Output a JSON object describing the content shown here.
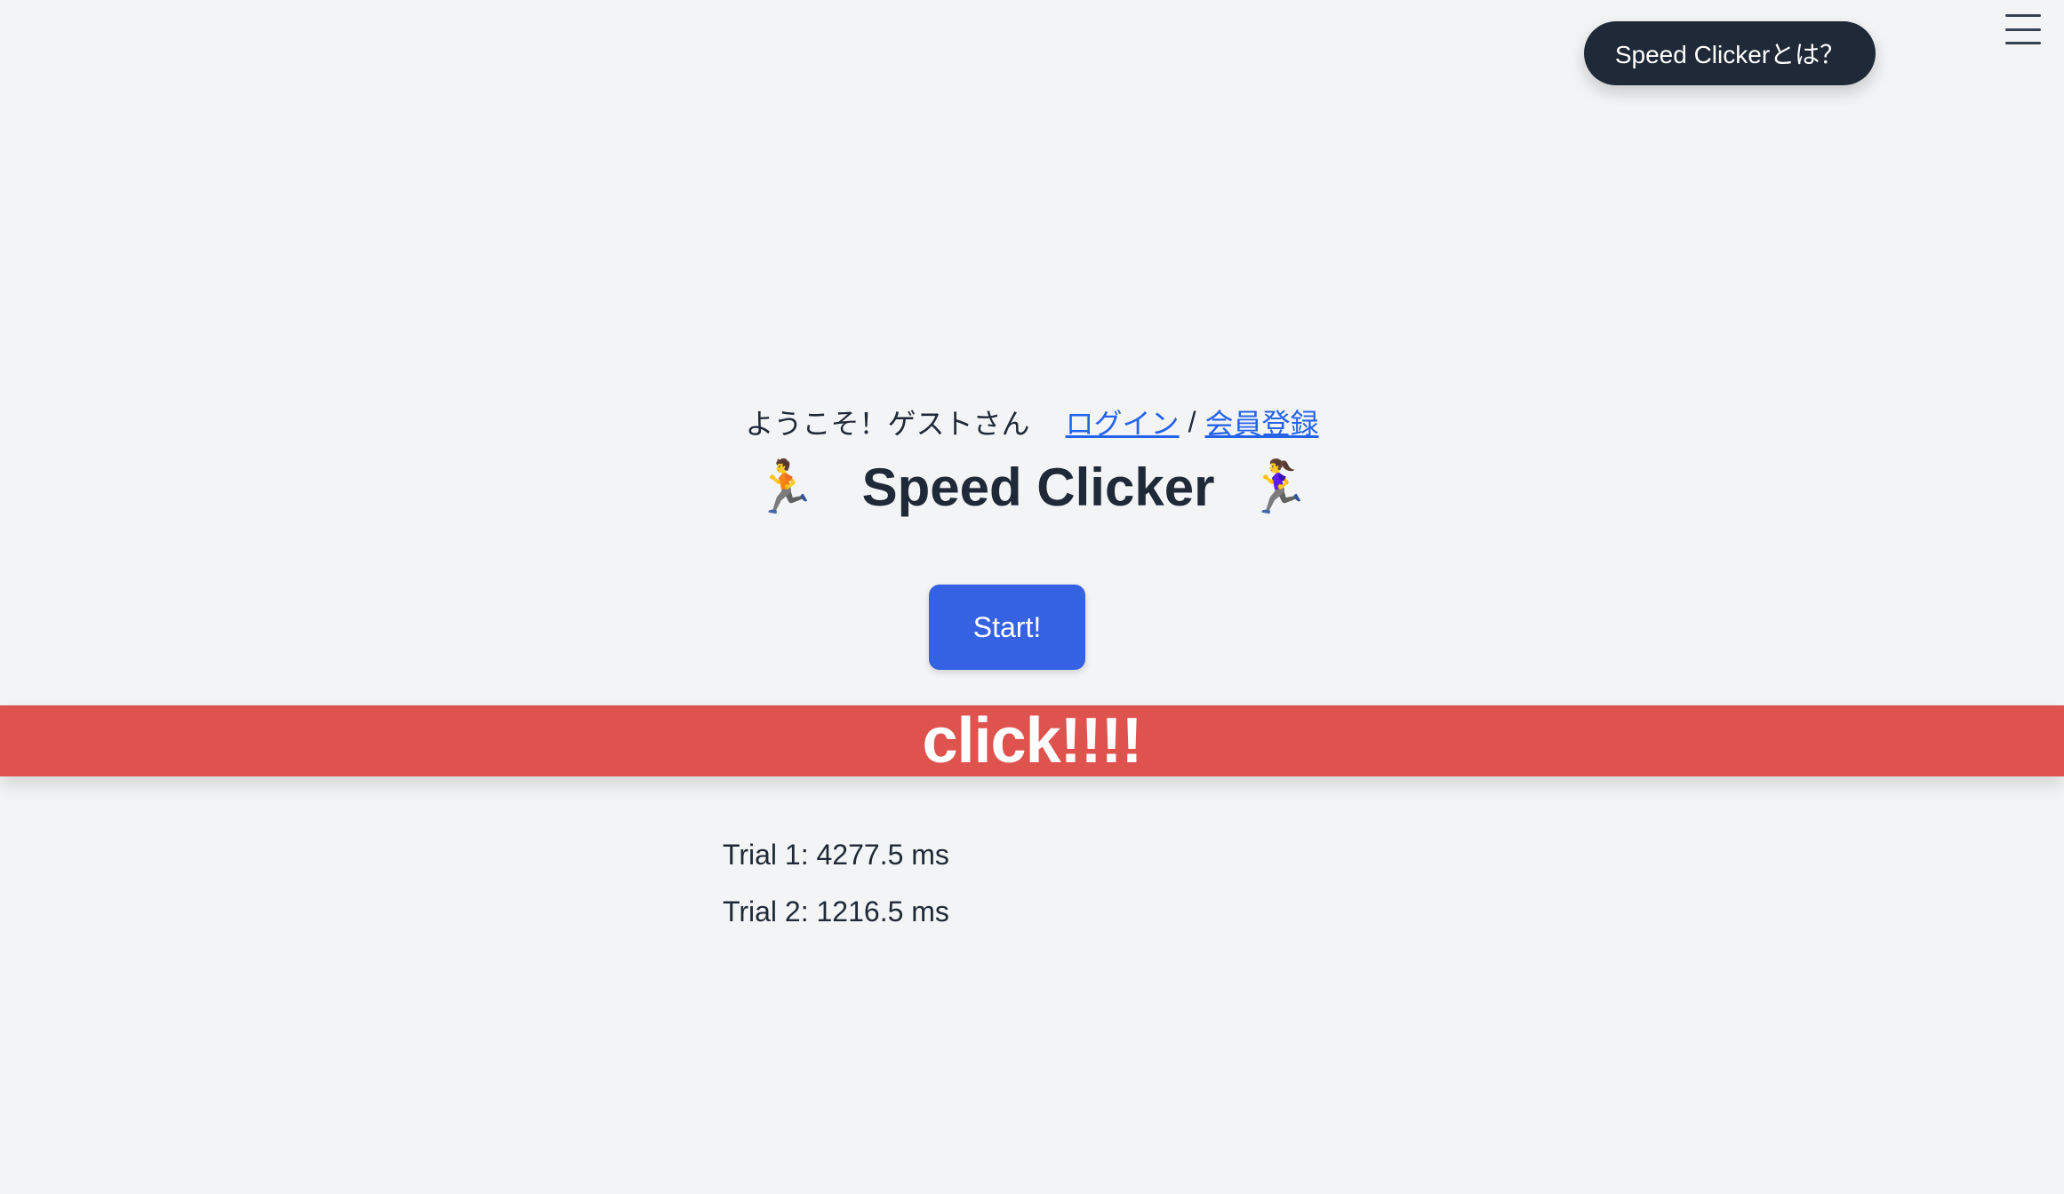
{
  "header": {
    "about_label": "Speed Clickerとは？",
    "menu_icon": "hamburger-menu-icon"
  },
  "welcome": {
    "greeting": "ようこそ！ゲストさん",
    "login_label": "ログイン",
    "separator": "/",
    "register_label": "会員登録"
  },
  "title": {
    "text": "Speed Clicker",
    "left_emoji": "🏃",
    "right_emoji": "🏃‍♀️"
  },
  "start_button": {
    "label": "Start!"
  },
  "click_bar": {
    "label": "click!!!!"
  },
  "trials": [
    "Trial 1: 4277.5 ms",
    "Trial 2: 1216.5 ms"
  ],
  "colors": {
    "background": "#f3f4f6",
    "pill": "#1f2937",
    "link": "#2563eb",
    "start_button": "#3561e3",
    "click_bar": "#df534f"
  }
}
